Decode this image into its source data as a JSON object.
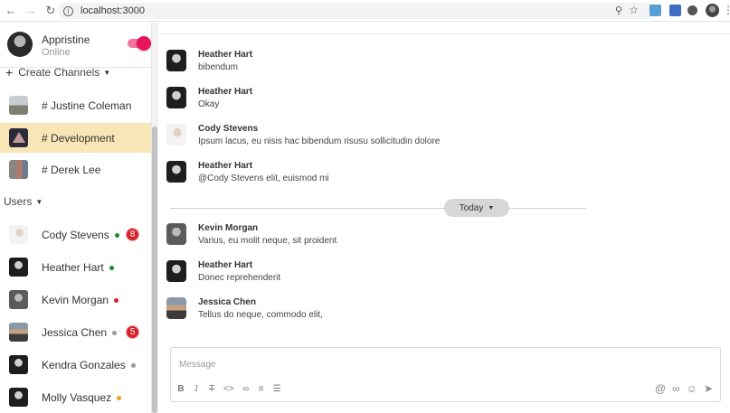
{
  "browser": {
    "url": "localhost:3000"
  },
  "profile": {
    "name": "Appristine",
    "status": "Online"
  },
  "sections": {
    "channels": "Create Channels",
    "users": "Users"
  },
  "channels": [
    {
      "label": "# Justine Coleman"
    },
    {
      "label": "# Development",
      "active": true
    },
    {
      "label": "# Derek Lee"
    }
  ],
  "users": [
    {
      "name": "Cody Stevens",
      "presence": "online",
      "dot_color": "#1e8a2a",
      "unread": "8"
    },
    {
      "name": "Heather Hart",
      "presence": "online",
      "dot_color": "#1e8a2a"
    },
    {
      "name": "Kevin Morgan",
      "presence": "busy",
      "dot_color": "#d6212b"
    },
    {
      "name": "Jessica Chen",
      "presence": "offline",
      "dot_color": "#9a9a9a",
      "unread": "5"
    },
    {
      "name": "Kendra Gonzales",
      "presence": "offline",
      "dot_color": "#9a9a9a"
    },
    {
      "name": "Molly Vasquez",
      "presence": "away",
      "dot_color": "#f0a020"
    }
  ],
  "messages": [
    {
      "author": "Heather Hart",
      "text": "bibendum"
    },
    {
      "author": "Heather Hart",
      "text": "Okay"
    },
    {
      "author": "Cody Stevens",
      "text": "Ipsum lacus, eu nisis hac bibendum risusu sollicitudin dolore"
    },
    {
      "author": "Heather Hart",
      "text": "@Cody Stevens elit, euismod mi"
    },
    {
      "author": "Kevin Morgan",
      "text": "Varius, eu molit neque, sit proident"
    },
    {
      "author": "Heather Hart",
      "text": "Donec reprehenderit"
    },
    {
      "author": "Jessica Chen",
      "text": "Tellus do neque, commodo elit,"
    }
  ],
  "divider": {
    "label": "Today"
  },
  "composer": {
    "placeholder": "Message"
  },
  "colors": {
    "accent": "#e8135c",
    "active_channel": "#f8e6b6",
    "badge": "#d6212b"
  }
}
